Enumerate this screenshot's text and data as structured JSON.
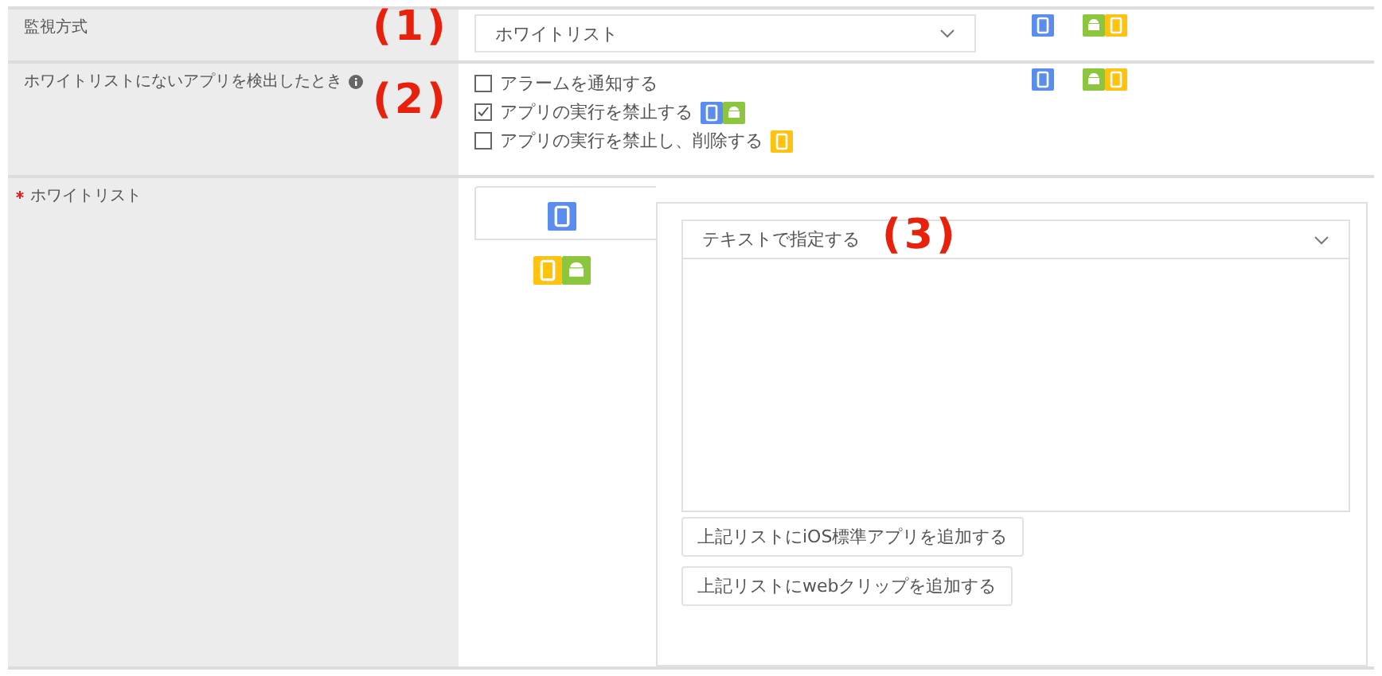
{
  "monitoring": {
    "label": "監視方式",
    "callout": "(1)",
    "value": "ホワイトリスト",
    "platform_columns": [
      [
        {
          "kind": "ios"
        }
      ],
      [
        {
          "kind": "android"
        },
        {
          "kind": "feature"
        }
      ]
    ]
  },
  "detection": {
    "label": "ホワイトリストにないアプリを検出したとき",
    "callout": "(2)",
    "platform_columns": [
      [
        {
          "kind": "ios"
        }
      ],
      [
        {
          "kind": "android"
        },
        {
          "kind": "feature"
        }
      ]
    ],
    "options": [
      {
        "label": "アラームを通知する",
        "checked": false
      },
      {
        "label": "アプリの実行を禁止する",
        "checked": true,
        "platforms": [
          {
            "kind": "ios"
          },
          {
            "kind": "android"
          }
        ]
      },
      {
        "label": "アプリの実行を禁止し、削除する",
        "checked": false,
        "platforms": [
          {
            "kind": "feature"
          }
        ]
      }
    ]
  },
  "whitelist": {
    "label": "ホワイトリスト",
    "required": true,
    "callout": "(3)",
    "tabs": [
      {
        "selected": true,
        "platforms": [
          {
            "kind": "ios"
          }
        ]
      },
      {
        "selected": false,
        "platforms": [
          {
            "kind": "feature"
          },
          {
            "kind": "android"
          }
        ]
      }
    ],
    "mode": "テキストで指定する",
    "buttons": [
      "上記リストにiOS標準アプリを追加する",
      "上記リストにwebクリップを追加する"
    ]
  }
}
